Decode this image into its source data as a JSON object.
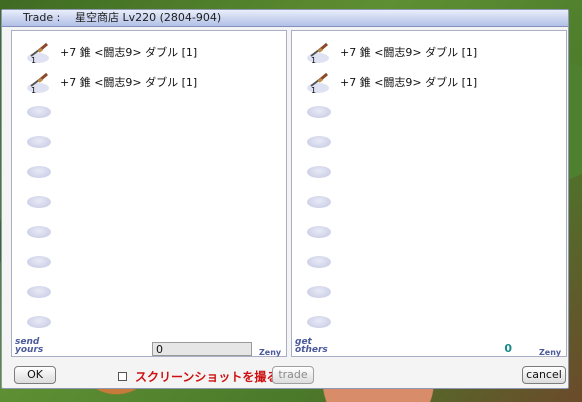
{
  "window": {
    "title_prefix": "Trade :",
    "title": "星空商店 Lv220 (2804-904)"
  },
  "left_panel": {
    "items": [
      {
        "name": "+7 錐 <闘志9> ダブル [1]",
        "quantity": "1"
      },
      {
        "name": "+7 錐 <闘志9> ダブル [1]",
        "quantity": "1"
      }
    ],
    "empty_slots": 8,
    "corner_label_line1": "send",
    "corner_label_line2": "yours",
    "zeny_value": "0",
    "zeny_label": "Zeny"
  },
  "right_panel": {
    "items": [
      {
        "name": "+7 錐 <闘志9> ダブル [1]",
        "quantity": "1"
      },
      {
        "name": "+7 錐 <闘志9> ダブル [1]",
        "quantity": "1"
      }
    ],
    "empty_slots": 8,
    "corner_label_line1": "get",
    "corner_label_line2": "others",
    "zeny_value": "0",
    "zeny_label": "Zeny"
  },
  "bottom": {
    "ok_label": "OK",
    "screenshot_checkbox_label": "スクリーンショットを撮る",
    "screenshot_checked": false,
    "trade_label": "trade",
    "cancel_label": "cancel"
  },
  "colors": {
    "title_bar": "#c7d2ee",
    "checkbox_label": "#d01010",
    "zeny_other": "#1a8a8a"
  },
  "icons": {
    "item": "awl-dagger-icon",
    "empty_slot": "empty-slot-icon"
  }
}
